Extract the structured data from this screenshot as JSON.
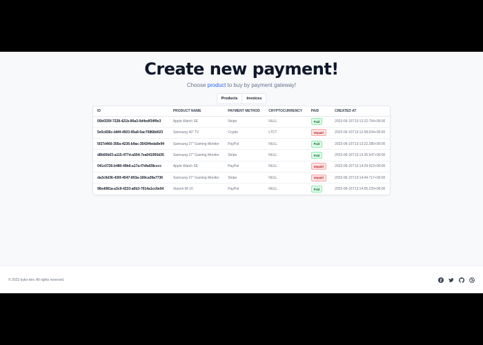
{
  "hero": {
    "title": "Create new payment!",
    "subtitle_prefix": "Choose ",
    "subtitle_link": "product",
    "subtitle_suffix": " to buy by payment gateway!"
  },
  "tabs": [
    {
      "label": "Products"
    },
    {
      "label": "Invoices"
    }
  ],
  "table": {
    "headers": [
      "ID",
      "Product name",
      "Payment method",
      "Cryptocurrency",
      "Paid",
      "Created at"
    ],
    "rows": [
      {
        "id": "05bf335f-7228-421b-80a3-0d4edf34f9e3",
        "product": "Apple Watch SE",
        "method": "Stripe",
        "crypto": "NULL",
        "paid": "Paid",
        "created": "2023-06-15T13:12:22.754+00:00"
      },
      {
        "id": "5e5c836c-b84f-4503-95a9-5ac70868d023",
        "product": "Samsung 40\" TV",
        "method": "Crypto",
        "crypto": "LTCT",
        "paid": "Unpaid",
        "created": "2023-06-15T13:12:58.634+00:00"
      },
      {
        "id": "5f27d460-356a-4236-b9ac-3543f4eda9e94",
        "product": "Samsung 27\" Gaming Monitor",
        "method": "PayPal",
        "crypto": "NULL",
        "paid": "Paid",
        "created": "2023-06-15T13:13:22.280+00:00"
      },
      {
        "id": "d8b50b03-a115-477d-a554-7ea041950d35",
        "product": "Samsung 27\" Gaming Monitor",
        "method": "Stripe",
        "crypto": "NULL",
        "paid": "Paid",
        "created": "2023-06-15T13:13:35.547+00:00"
      },
      {
        "id": "041c0726-b480-49b6-a17a-f7dfaf28cccc",
        "product": "Apple Watch SE",
        "method": "PayPal",
        "crypto": "NULL",
        "paid": "Unpaid",
        "created": "2023-06-15T13:14:29.919+00:00"
      },
      {
        "id": "da3c9d36-430f-4547-803a-169ca39a7736",
        "product": "Samsung 27\" Gaming Monitor",
        "method": "Stripe",
        "crypto": "NULL",
        "paid": "Unpaid",
        "created": "2023-06-15T13:14:44.717+00:00"
      },
      {
        "id": "96ed081a-a3c9-4233-a6b3-7014a1cc6e04",
        "product": "Xiaomi Mi 10",
        "method": "PayPal",
        "crypto": "NULL",
        "paid": "Paid",
        "created": "2023-06-15T13:14:55.229+00:00"
      }
    ]
  },
  "footer": {
    "copyright": "© 2023 byko-dev. All rights reserved.",
    "socials": [
      {
        "name": "facebook-icon"
      },
      {
        "name": "twitter-icon"
      },
      {
        "name": "github-icon"
      },
      {
        "name": "dribbble-icon"
      }
    ]
  },
  "colors": {
    "link": "#2563eb",
    "paid_bg": "#dcfce7",
    "paid_text": "#166534",
    "unpaid_bg": "#fee2e2",
    "unpaid_text": "#b91c1c"
  }
}
